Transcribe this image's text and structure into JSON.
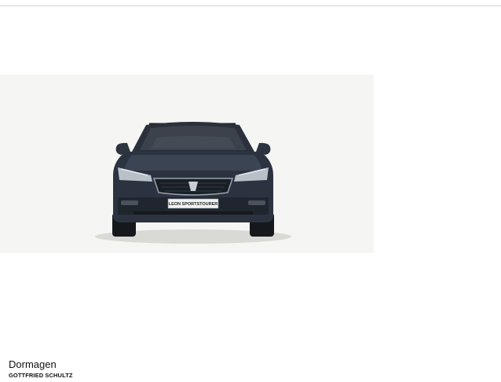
{
  "vehicle": {
    "plate_text": "LEON SPORTSTOURER",
    "body_color": "#2b3340"
  },
  "dealer": {
    "city": "Dormagen",
    "brand": "GOTTFRIED SCHULTZ"
  }
}
